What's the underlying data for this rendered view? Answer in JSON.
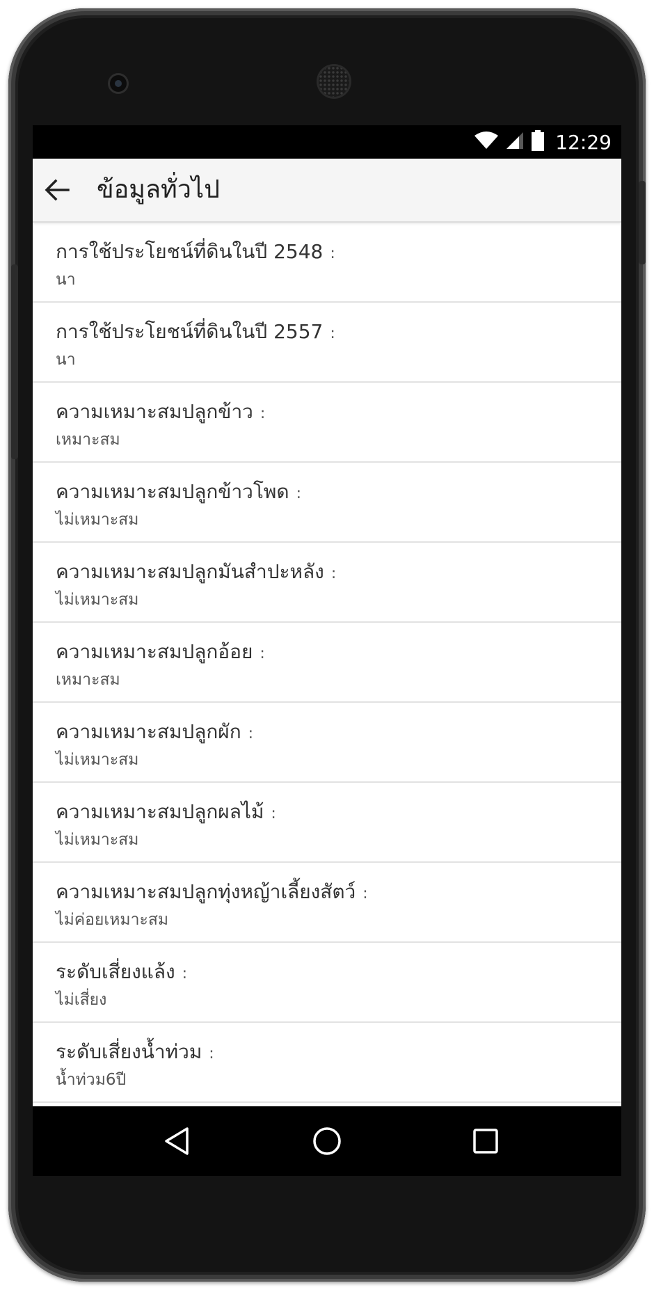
{
  "status_bar": {
    "time": "12:29",
    "icons": [
      "wifi-icon",
      "cell-signal-icon",
      "battery-icon"
    ]
  },
  "app_bar": {
    "title": "ข้อมูลทั่วไป",
    "back_icon": "arrow-back-icon"
  },
  "items": [
    {
      "label": "การใช้ประโยชน์ที่ดินในปี 2548",
      "colon": ":",
      "value": "นา"
    },
    {
      "label": "การใช้ประโยชน์ที่ดินในปี 2557",
      "colon": ":",
      "value": "นา"
    },
    {
      "label": "ความเหมาะสมปลูกข้าว",
      "colon": ":",
      "value": "เหมาะสม"
    },
    {
      "label": "ความเหมาะสมปลูกข้าวโพด",
      "colon": ":",
      "value": "ไม่เหมาะสม"
    },
    {
      "label": "ความเหมาะสมปลูกมันสำปะหลัง",
      "colon": ":",
      "value": "ไม่เหมาะสม"
    },
    {
      "label": "ความเหมาะสมปลูกอ้อย",
      "colon": ":",
      "value": "เหมาะสม"
    },
    {
      "label": "ความเหมาะสมปลูกผัก",
      "colon": ":",
      "value": "ไม่เหมาะสม"
    },
    {
      "label": "ความเหมาะสมปลูกผลไม้",
      "colon": ":",
      "value": "ไม่เหมาะสม"
    },
    {
      "label": "ความเหมาะสมปลูกทุ่งหญ้าเลี้ยงสัตว์",
      "colon": ":",
      "value": "ไม่ค่อยเหมาะสม"
    },
    {
      "label": "ระดับเสี่ยงแล้ง",
      "colon": ":",
      "value": "ไม่เสี่ยง"
    },
    {
      "label": "ระดับเสี่ยงน้ำท่วม",
      "colon": ":",
      "value": "น้ำท่วม6ปี"
    }
  ],
  "nav_bar": {
    "buttons": [
      "back-triangle-icon",
      "home-circle-icon",
      "recents-square-icon"
    ]
  },
  "colors": {
    "app_bar_bg": "#f5f5f5",
    "status_bar_bg": "#000000",
    "divider": "#e2e2e2",
    "text_primary": "#333333",
    "text_secondary": "#555555"
  }
}
